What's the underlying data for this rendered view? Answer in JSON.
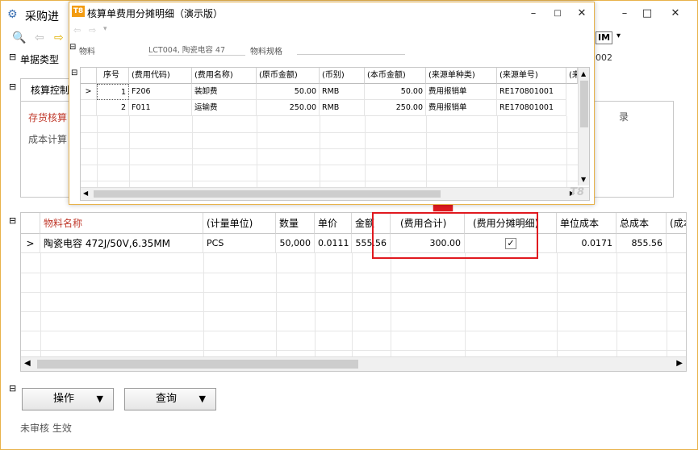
{
  "window": {
    "title": "采购进",
    "toolbar_partial_text": "IM",
    "right_code": "002"
  },
  "left_labels": {
    "doc_type": "单据类型",
    "tab": "核算控制",
    "sub1": "存货核算",
    "sub2": "成本计算",
    "right_hint": "录"
  },
  "main_grid": {
    "columns": [
      "物料名称",
      "(计量单位)",
      "数量",
      "单价",
      "金额",
      "(费用合计)",
      "(费用分摊明细)",
      "单位成本",
      "总成本",
      "(成本项"
    ],
    "row": {
      "marker": ">",
      "name": "陶瓷电容  472J/50V,6.35MM",
      "unit": "PCS",
      "qty": "50,000",
      "price": "0.0111",
      "amount": "555.56",
      "fee_total": "300.00",
      "fee_detail_checked": true,
      "unit_cost": "0.0171",
      "total_cost": "855.56"
    }
  },
  "actions": {
    "operate": "操作",
    "query": "查询"
  },
  "status": "未审核 生效",
  "popup": {
    "title": "核算单费用分摊明细（演示版）",
    "logo_text": "T8",
    "watermark": "T8",
    "material_label": "物料",
    "material_value": "LCT004, 陶瓷电容  47",
    "spec_label": "物料规格",
    "columns": [
      "序号",
      "(费用代码)",
      "(费用名称)",
      "(原币金额)",
      "(币别)",
      "(本币金额)",
      "(来源单种类)",
      "(来源单号)",
      "(来"
    ],
    "rows": [
      {
        "marker": ">",
        "no": "1",
        "code": "F206",
        "name": "装卸费",
        "orig": "50.00",
        "cur": "RMB",
        "local": "50.00",
        "src_type": "费用报销单",
        "src_no": "RE170801001"
      },
      {
        "marker": "",
        "no": "2",
        "code": "F011",
        "name": "运输费",
        "orig": "250.00",
        "cur": "RMB",
        "local": "250.00",
        "src_type": "费用报销单",
        "src_no": "RE170801001"
      }
    ]
  },
  "colors": {
    "accent_border": "#e8b24a",
    "highlight": "#e0191f",
    "arrow": "#e0191f",
    "header_text_red": "#c0392b"
  }
}
